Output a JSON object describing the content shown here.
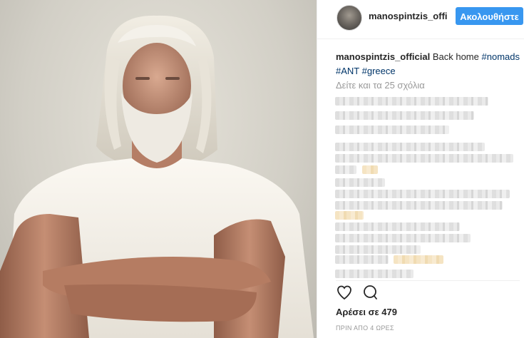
{
  "post": {
    "image_alt": "Man with long white hair and beard in white t-shirt, arms crossed"
  },
  "header": {
    "username": "manospintzis_offi",
    "follow_label": "Ακολουθήστε"
  },
  "caption": {
    "author": "manospintzis_official",
    "text": "Back home",
    "hashtags": [
      "#nomads",
      "#ANT",
      "#greece"
    ]
  },
  "comments": {
    "view_all_label": "Δείτε και τα 25 σχόλια"
  },
  "footer": {
    "likes_label": "Αρέσει σε 479",
    "timestamp": "ΠΡΙΝ ΑΠΟ 4 ΩΡΕΣ"
  },
  "colors": {
    "accent": "#3897f0",
    "hashtag": "#003569",
    "muted": "#999999",
    "text": "#262626"
  },
  "icons": {
    "like": "heart-icon",
    "comment": "comment-icon"
  }
}
